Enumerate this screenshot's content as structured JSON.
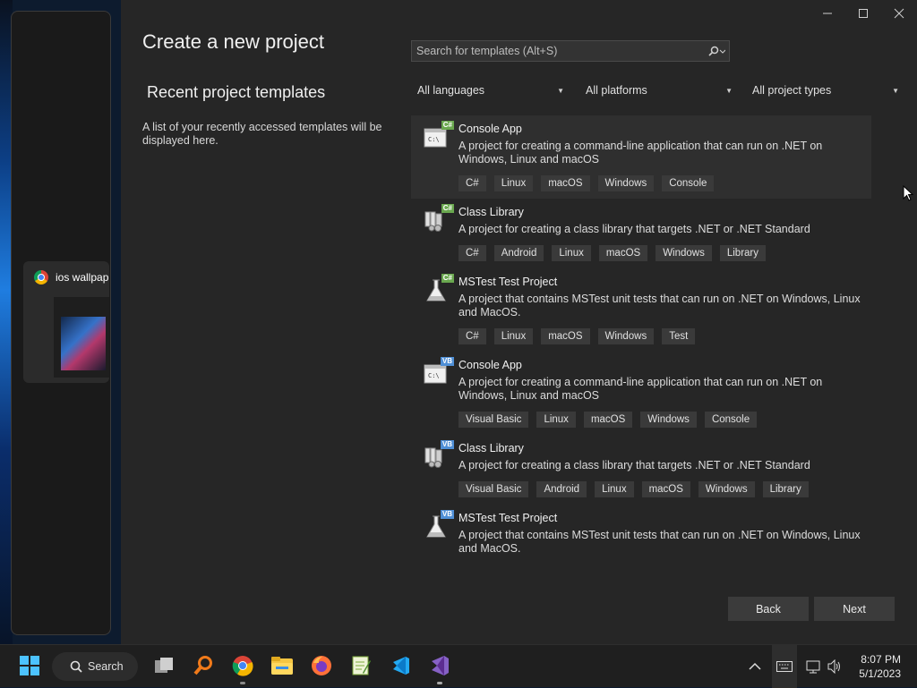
{
  "snap_assist": {
    "app_title": "ios wallpap",
    "app_icon": "chrome-icon"
  },
  "window": {
    "title": "Create a new project",
    "controls": {
      "minimize": "—",
      "maximize": "☐",
      "close": "✕"
    }
  },
  "recent": {
    "heading": "Recent project templates",
    "description": "A list of your recently accessed templates will be displayed here."
  },
  "search": {
    "placeholder": "Search for templates (Alt+S)"
  },
  "filters": {
    "languages": "All languages",
    "platforms": "All platforms",
    "project_types": "All project types"
  },
  "templates": [
    {
      "name": "Console App",
      "lang_badge": "C#",
      "icon": "console-app-icon",
      "description": "A project for creating a command-line application that can run on .NET on Windows, Linux and macOS",
      "tags": [
        "C#",
        "Linux",
        "macOS",
        "Windows",
        "Console"
      ]
    },
    {
      "name": "Class Library",
      "lang_badge": "C#",
      "icon": "class-library-icon",
      "description": "A project for creating a class library that targets .NET or .NET Standard",
      "tags": [
        "C#",
        "Android",
        "Linux",
        "macOS",
        "Windows",
        "Library"
      ]
    },
    {
      "name": "MSTest Test Project",
      "lang_badge": "C#",
      "icon": "test-flask-icon",
      "description": "A project that contains MSTest unit tests that can run on .NET on Windows, Linux and MacOS.",
      "tags": [
        "C#",
        "Linux",
        "macOS",
        "Windows",
        "Test"
      ]
    },
    {
      "name": "Console App",
      "lang_badge": "VB",
      "icon": "console-app-icon",
      "description": "A project for creating a command-line application that can run on .NET on Windows, Linux and macOS",
      "tags": [
        "Visual Basic",
        "Linux",
        "macOS",
        "Windows",
        "Console"
      ]
    },
    {
      "name": "Class Library",
      "lang_badge": "VB",
      "icon": "class-library-icon",
      "description": "A project for creating a class library that targets .NET or .NET Standard",
      "tags": [
        "Visual Basic",
        "Android",
        "Linux",
        "macOS",
        "Windows",
        "Library"
      ]
    },
    {
      "name": "MSTest Test Project",
      "lang_badge": "VB",
      "icon": "test-flask-icon",
      "description": "A project that contains MSTest unit tests that can run on .NET on Windows, Linux and MacOS.",
      "tags": []
    }
  ],
  "buttons": {
    "back": "Back",
    "next": "Next"
  },
  "taskbar": {
    "search_label": "Search",
    "apps": [
      "start-icon",
      "task-view-icon",
      "magnifier-icon",
      "chrome-icon",
      "file-explorer-icon",
      "firefox-icon",
      "notepad-plus-icon",
      "vs-code-icon",
      "visual-studio-icon"
    ],
    "time": "8:07 PM",
    "date": "5/1/2023"
  },
  "colors": {
    "accent_badge_csharp": "#6aa84f",
    "accent_badge_vb": "#4f8fd6",
    "window_bg": "#262626"
  }
}
